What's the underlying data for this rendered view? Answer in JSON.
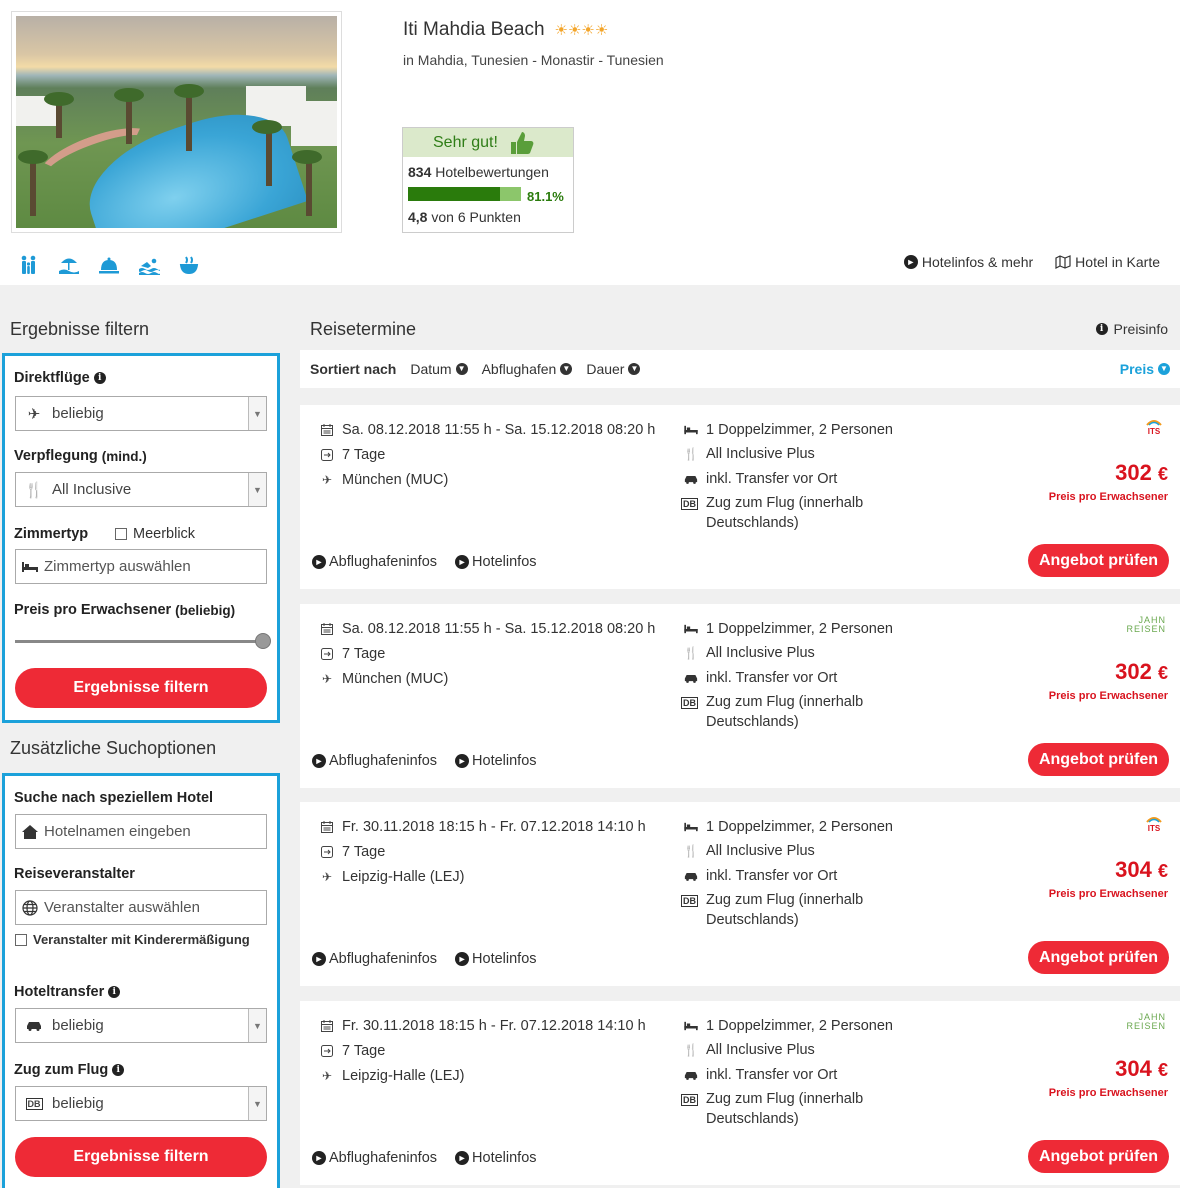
{
  "hotel": {
    "name": "Iti Mahdia Beach",
    "stars": "☀☀☀☀",
    "location": "in Mahdia, Tunesien - Monastir - Tunesien",
    "rating": {
      "label": "Sehr gut!",
      "count": "834",
      "count_suffix": "Hotelbewertungen",
      "percent": "81.1%",
      "percent_value": 81.1,
      "score": "4,8",
      "score_suffix": "von 6 Punkten"
    },
    "amenities": [
      "family-icon",
      "beach-icon",
      "service-bell-icon",
      "swimming-icon",
      "spa-icon"
    ],
    "links": {
      "info": "Hotelinfos & mehr",
      "map": "Hotel in Karte"
    }
  },
  "filter": {
    "title": "Ergebnisse filtern",
    "direktfluege": {
      "label": "Direktflüge",
      "value": "beliebig"
    },
    "verpflegung": {
      "label": "Verpflegung",
      "label_suffix": "(mind.)",
      "value": "All Inclusive"
    },
    "zimmertyp": {
      "label": "Zimmertyp",
      "checkbox_label": "Meerblick",
      "placeholder": "Zimmertyp auswählen"
    },
    "preis": {
      "label": "Preis pro Erwachsener",
      "label_suffix": "(beliebig)",
      "slider_value": 1.0
    },
    "button": "Ergebnisse filtern"
  },
  "extra": {
    "title": "Zusätzliche Suchoptionen",
    "hotel_search": {
      "label": "Suche nach speziellem Hotel",
      "placeholder": "Hotelnamen eingeben"
    },
    "veranstalter": {
      "label": "Reiseveranstalter",
      "placeholder": "Veranstalter auswählen",
      "checkbox_label": "Veranstalter mit Kinderermäßigung"
    },
    "transfer": {
      "label": "Hoteltransfer",
      "value": "beliebig"
    },
    "zug": {
      "label": "Zug zum Flug",
      "value": "beliebig"
    },
    "button": "Ergebnisse filtern"
  },
  "results": {
    "title": "Reisetermine",
    "preisinfo": "Preisinfo",
    "sort": {
      "label": "Sortiert nach",
      "options": [
        "Datum",
        "Abflughafen",
        "Dauer"
      ],
      "active": "Preis"
    },
    "offers": [
      {
        "dates": "Sa. 08.12.2018 11:55 h - Sa. 15.12.2018 08:20 h",
        "duration": "7 Tage",
        "airport": "München (MUC)",
        "room": "1 Doppelzimmer, 2 Personen",
        "board": "All Inclusive Plus",
        "transfer": "inkl. Transfer vor Ort",
        "zug": "Zug zum Flug (innerhalb Deutschlands)",
        "operator": "ITS",
        "price": "302",
        "currency": "€",
        "price_note": "Preis pro Erwachsener",
        "link_airport": "Abflughafeninfos",
        "link_hotel": "Hotelinfos",
        "cta": "Angebot prüfen"
      },
      {
        "dates": "Sa. 08.12.2018 11:55 h - Sa. 15.12.2018 08:20 h",
        "duration": "7 Tage",
        "airport": "München (MUC)",
        "room": "1 Doppelzimmer, 2 Personen",
        "board": "All Inclusive Plus",
        "transfer": "inkl. Transfer vor Ort",
        "zug": "Zug zum Flug (innerhalb Deutschlands)",
        "operator": "JAHN REISEN",
        "price": "302",
        "currency": "€",
        "price_note": "Preis pro Erwachsener",
        "link_airport": "Abflughafeninfos",
        "link_hotel": "Hotelinfos",
        "cta": "Angebot prüfen"
      },
      {
        "dates": "Fr. 30.11.2018 18:15 h - Fr. 07.12.2018 14:10 h",
        "duration": "7 Tage",
        "airport": "Leipzig-Halle (LEJ)",
        "room": "1 Doppelzimmer, 2 Personen",
        "board": "All Inclusive Plus",
        "transfer": "inkl. Transfer vor Ort",
        "zug": "Zug zum Flug (innerhalb Deutschlands)",
        "operator": "ITS",
        "price": "304",
        "currency": "€",
        "price_note": "Preis pro Erwachsener",
        "link_airport": "Abflughafeninfos",
        "link_hotel": "Hotelinfos",
        "cta": "Angebot prüfen"
      },
      {
        "dates": "Fr. 30.11.2018 18:15 h - Fr. 07.12.2018 14:10 h",
        "duration": "7 Tage",
        "airport": "Leipzig-Halle (LEJ)",
        "room": "1 Doppelzimmer, 2 Personen",
        "board": "All Inclusive Plus",
        "transfer": "inkl. Transfer vor Ort",
        "zug": "Zug zum Flug (innerhalb Deutschlands)",
        "operator": "JAHN REISEN",
        "price": "304",
        "currency": "€",
        "price_note": "Preis pro Erwachsener",
        "link_airport": "Abflughafeninfos",
        "link_hotel": "Hotelinfos",
        "cta": "Angebot prüfen"
      }
    ]
  },
  "colors": {
    "accent_blue": "#1ba1da",
    "cta_red": "#ee2a36",
    "price_red": "#d9131e",
    "rating_green": "#2a7b0c"
  }
}
